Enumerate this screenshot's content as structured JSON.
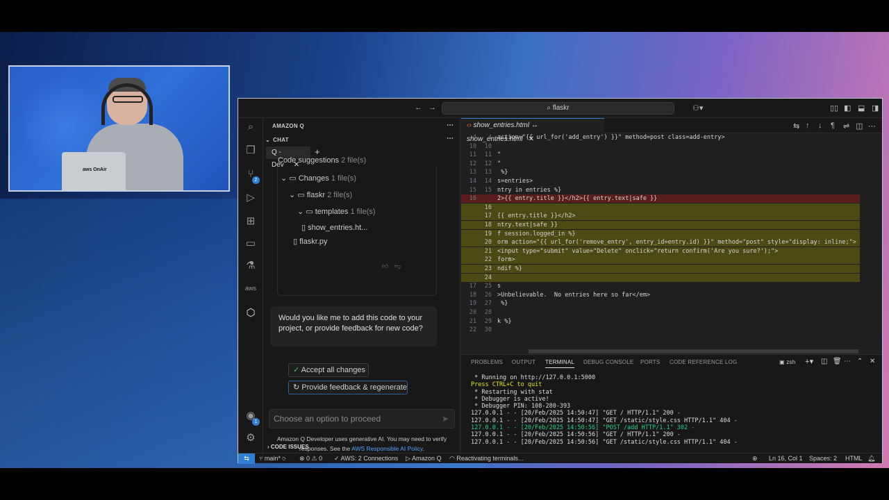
{
  "titlebar": {
    "search": "flaskr"
  },
  "chat": {
    "panel_title": "AMAZON Q",
    "section": "CHAT",
    "tab": "Q - Dev",
    "code_suggestions": "Code suggestions",
    "code_suggestions_count": "2 file(s)",
    "tree": [
      {
        "label": "Changes",
        "count": "1 file(s)"
      },
      {
        "label": "flaskr",
        "count": "2 file(s)"
      },
      {
        "label": "templates",
        "count": "1 file(s)"
      },
      {
        "label": "show_entries.ht...",
        "count": ""
      },
      {
        "label": "flaskr.py",
        "count": ""
      }
    ],
    "question": "Would you like me to add this code to your project, or provide feedback for new code?",
    "accept_button": "Accept all changes",
    "feedback_button": "Provide feedback & regenerate",
    "input_placeholder": "Choose an option to proceed",
    "disclaimer": "Amazon Q Developer uses generative AI. You may need to verify responses. See the",
    "disclaimer_link": "AWS Responsible AI Policy",
    "disclaimer_end": ".",
    "code_issues": "CODE ISSUES"
  },
  "editor": {
    "tab_title": "show_entries.html ↔ show_entries.html",
    "lines": [
      {
        "n1": "4",
        "n2": "4",
        "text": "action=\"{{ url_for('add_entry') }}\" method=post class=add-entry>",
        "type": ""
      },
      {
        "n1": "10",
        "n2": "10",
        "text": "",
        "type": ""
      },
      {
        "n1": "11",
        "n2": "11",
        "text": "\"",
        "type": ""
      },
      {
        "n1": "12",
        "n2": "12",
        "text": "\"",
        "type": ""
      },
      {
        "n1": "13",
        "n2": "13",
        "text": " %}",
        "type": ""
      },
      {
        "n1": "14",
        "n2": "14",
        "text": "s=entries>",
        "type": ""
      },
      {
        "n1": "15",
        "n2": "15",
        "text": "ntry in entries %}",
        "type": ""
      },
      {
        "n1": "16",
        "n2": "",
        "text": "2>{{ entry.title }}</h2>{{ entry.text|safe }}",
        "type": "del"
      },
      {
        "n1": "",
        "n2": "16",
        "text": "",
        "type": "add"
      },
      {
        "n1": "",
        "n2": "17",
        "text": "{{ entry.title }}</h2>",
        "type": "add"
      },
      {
        "n1": "",
        "n2": "18",
        "text": "ntry.text|safe }}",
        "type": "add"
      },
      {
        "n1": "",
        "n2": "19",
        "text": "f session.logged_in %}",
        "type": "add"
      },
      {
        "n1": "",
        "n2": "20",
        "text": "orm action=\"{{ url_for('remove_entry', entry_id=entry.id) }}\" method=\"post\" style=\"display: inline;\">",
        "type": "add"
      },
      {
        "n1": "",
        "n2": "21",
        "text": "<input type=\"submit\" value=\"Delete\" onclick=\"return confirm('Are you sure?');\">",
        "type": "add"
      },
      {
        "n1": "",
        "n2": "22",
        "text": "form>",
        "type": "add"
      },
      {
        "n1": "",
        "n2": "23",
        "text": "ndif %}",
        "type": "add"
      },
      {
        "n1": "",
        "n2": "24",
        "text": "",
        "type": "add"
      },
      {
        "n1": "17",
        "n2": "25",
        "text": "s",
        "type": ""
      },
      {
        "n1": "18",
        "n2": "26",
        "text": ">Unbelievable.  No entries here so far</em>",
        "type": ""
      },
      {
        "n1": "19",
        "n2": "27",
        "text": " %}",
        "type": ""
      },
      {
        "n1": "20",
        "n2": "28",
        "text": "",
        "type": ""
      },
      {
        "n1": "21",
        "n2": "29",
        "text": "k %}",
        "type": ""
      },
      {
        "n1": "22",
        "n2": "30",
        "text": "",
        "type": ""
      }
    ]
  },
  "panel": {
    "tabs": [
      "PROBLEMS",
      "OUTPUT",
      "TERMINAL",
      "DEBUG CONSOLE",
      "PORTS",
      "CODE REFERENCE LOG"
    ],
    "active_tab": "TERMINAL",
    "shell": "zsh",
    "terminal_lines": [
      " * Running on http://127.0.0.1:5000",
      "Press CTRL+C to quit",
      " * Restarting with stat",
      " * Debugger is active!",
      " * Debugger PIN: 108-280-393",
      "127.0.0.1 - - [20/Feb/2025 14:50:47] \"GET / HTTP/1.1\" 200 -",
      "127.0.0.1 - - [20/Feb/2025 14:50:47] \"GET /static/style.css HTTP/1.1\" 404 -",
      "127.0.0.1 - - [20/Feb/2025 14:50:56] \"POST /add HTTP/1.1\" 302 -",
      "127.0.0.1 - - [20/Feb/2025 14:50:56] \"GET / HTTP/1.1\" 200 -",
      "127.0.0.1 - - [20/Feb/2025 14:50:56] \"GET /static/style.css HTTP/1.1\" 404 -"
    ]
  },
  "statusbar": {
    "branch": "main*",
    "problems": "0 ⚠ 0",
    "aws": "AWS: 2 Connections",
    "amazonq": "Amazon Q",
    "activity": "Reactivating terminals...",
    "position": "Ln 16, Col 1",
    "spaces": "Spaces: 2",
    "language": "HTML"
  },
  "webcam": {
    "laptop_text": "aws OnAir"
  },
  "colors": {
    "accent": "#2f7fd6",
    "deleted_line": "#5a1d1d",
    "added_line": "#4b4a12"
  }
}
